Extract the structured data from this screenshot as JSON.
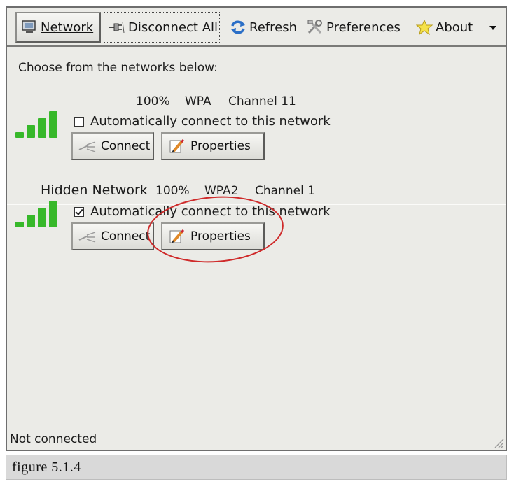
{
  "toolbar": {
    "network": "Network",
    "disconnect_all": "Disconnect All",
    "refresh": "Refresh",
    "preferences": "Preferences",
    "about": "About"
  },
  "content": {
    "heading": "Choose from the networks below:"
  },
  "networks": [
    {
      "name": "",
      "signal": "100%",
      "security": "WPA",
      "channel": "Channel 11",
      "auto_connect_label": "Automatically connect to this network",
      "auto_connect": false,
      "connect_label": "Connect",
      "properties_label": "Properties"
    },
    {
      "name": "Hidden Network",
      "signal": "100%",
      "security": "WPA2",
      "channel": "Channel 1",
      "auto_connect_label": "Automatically connect to this network",
      "auto_connect": true,
      "connect_label": "Connect",
      "properties_label": "Properties"
    }
  ],
  "status": {
    "text": "Not connected"
  },
  "caption": "figure 5.1.4",
  "colors": {
    "window_bg": "#ebebe7",
    "signal_green": "#37b82a",
    "annotation_red": "#cf2a2a"
  }
}
